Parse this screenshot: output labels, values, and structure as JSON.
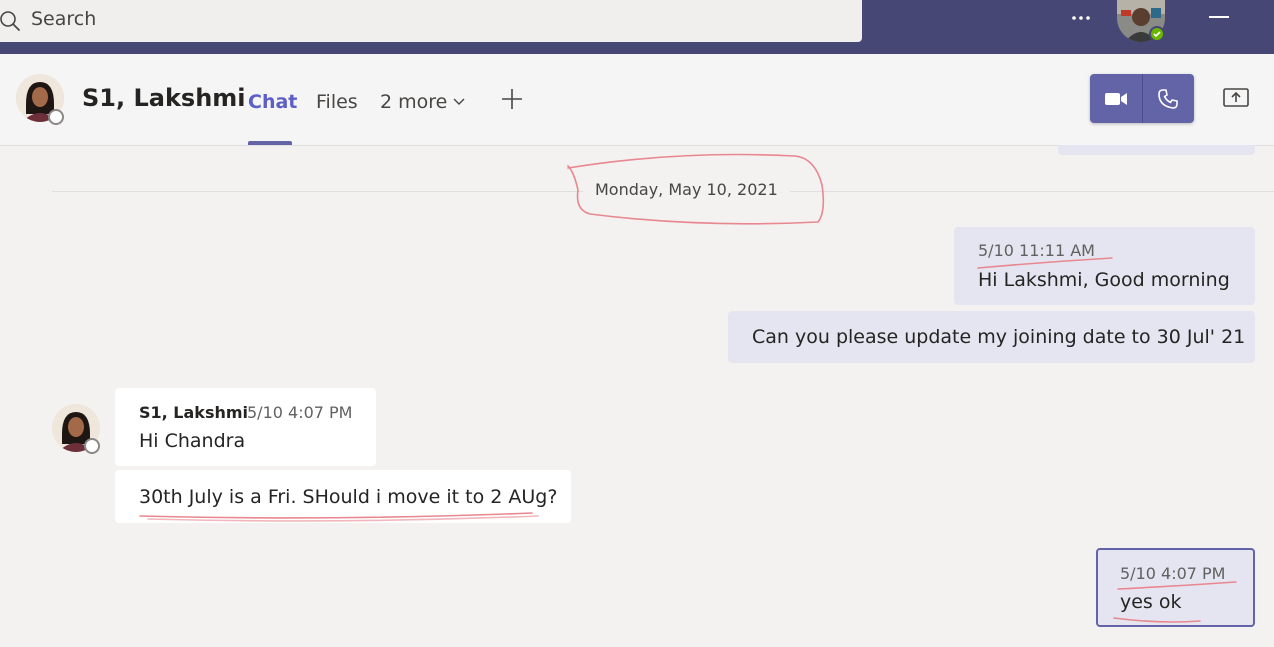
{
  "search": {
    "placeholder": "Search"
  },
  "topbar": {
    "more_label": "···"
  },
  "chat_header": {
    "contact_name": "S1, Lakshmi",
    "tabs": [
      {
        "label": "Chat",
        "active": true
      },
      {
        "label": "Files",
        "active": false
      },
      {
        "label": "2 more",
        "active": false
      }
    ],
    "actions": [
      "video-call-icon",
      "audio-call-icon",
      "share-screen-icon"
    ]
  },
  "conversation": {
    "date_divider": "Monday, May 10, 2021",
    "messages": [
      {
        "from": "me",
        "timestamp": "5/10 11:11 AM",
        "text": "Hi Lakshmi, Good morning"
      },
      {
        "from": "me",
        "timestamp": "",
        "text": "Can you please update my joining date to 30 Jul' 21"
      },
      {
        "from": "them",
        "sender": "S1, Lakshmi",
        "timestamp": "5/10 4:07 PM",
        "text": "Hi Chandra"
      },
      {
        "from": "them",
        "timestamp": "",
        "text": "30th July is a Fri. SHould i move it to 2 AUg?"
      },
      {
        "from": "me",
        "timestamp": "5/10 4:07 PM",
        "text": "yes ok",
        "selected": true
      }
    ]
  },
  "colors": {
    "brand": "#464775",
    "accent": "#6264a7",
    "my_bubble": "#e5e5f1",
    "their_bubble": "#ffffff",
    "annotation": "#e8878f",
    "presence_available": "#6bb700"
  }
}
